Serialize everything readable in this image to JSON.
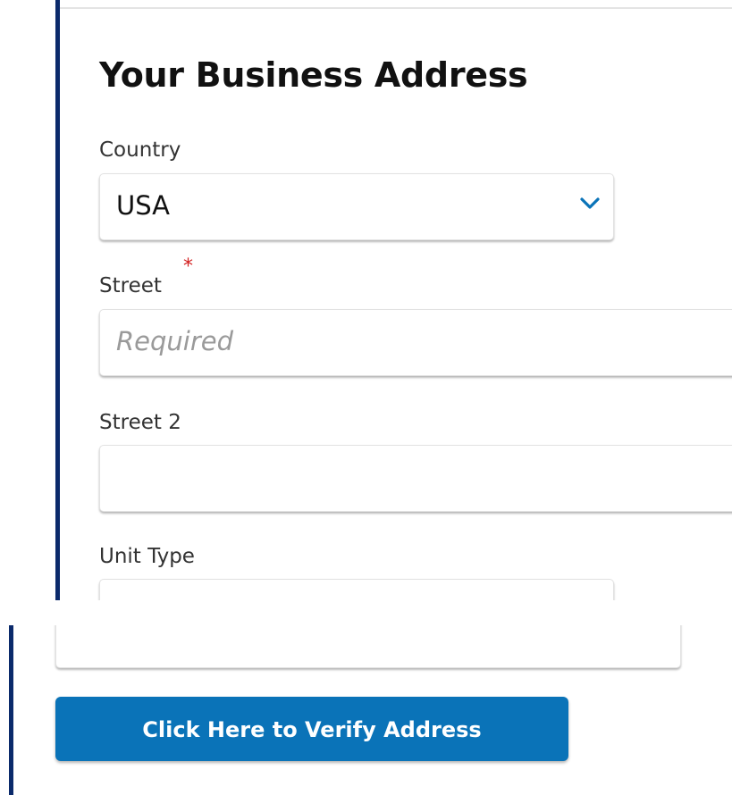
{
  "form": {
    "title": "Your Business Address",
    "country": {
      "label": "Country",
      "value": "USA",
      "icon": "chevron-down-icon",
      "icon_color": "#0a73b8"
    },
    "street": {
      "label": "Street",
      "required_mark": "*",
      "placeholder": "Required"
    },
    "street2": {
      "label": "Street 2",
      "value": ""
    },
    "unit_type": {
      "label": "Unit Type",
      "value": ""
    },
    "verify_button": {
      "label": "Click Here to Verify Address"
    }
  },
  "colors": {
    "accent_bar": "#0b2a6b",
    "button": "#0a73b8",
    "required": "#d21f1f"
  }
}
